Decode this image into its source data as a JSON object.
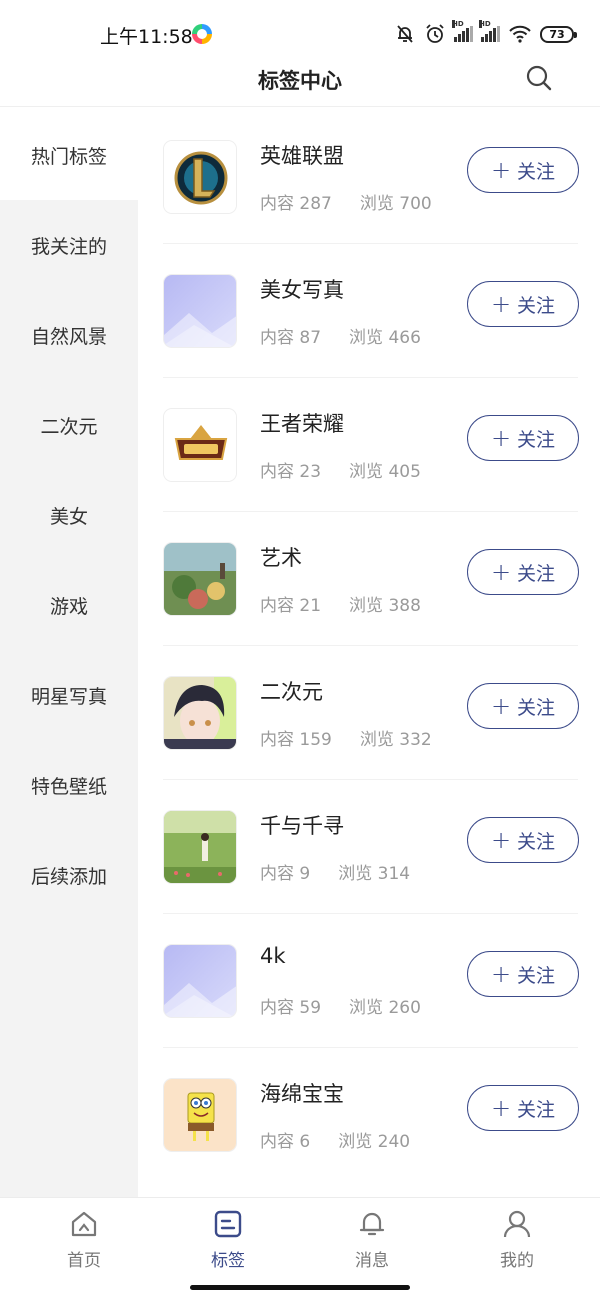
{
  "status_bar": {
    "time": "上午11:58",
    "battery": "73",
    "icons": [
      "mute-bell-icon",
      "alarm-icon",
      "signal-icon",
      "signal-icon",
      "wifi-icon",
      "battery-icon"
    ],
    "signal_badge": "HD"
  },
  "header": {
    "title": "标签中心",
    "search_icon": "search-icon"
  },
  "sidebar": {
    "items": [
      {
        "label": "热门标签"
      },
      {
        "label": "我关注的"
      },
      {
        "label": "自然风景"
      },
      {
        "label": "二次元"
      },
      {
        "label": "美女"
      },
      {
        "label": "游戏"
      },
      {
        "label": "明星写真"
      },
      {
        "label": "特色壁纸"
      },
      {
        "label": "后续添加"
      }
    ],
    "active_index": 0
  },
  "tags": [
    {
      "name": "英雄联盟",
      "content_label": "内容",
      "content": "287",
      "views_label": "浏览",
      "views": "700",
      "thumb": "lol-logo"
    },
    {
      "name": "美女写真",
      "content_label": "内容",
      "content": "87",
      "views_label": "浏览",
      "views": "466",
      "thumb": "placeholder"
    },
    {
      "name": "王者荣耀",
      "content_label": "内容",
      "content": "23",
      "views_label": "浏览",
      "views": "405",
      "thumb": "honor-of-kings-logo"
    },
    {
      "name": "艺术",
      "content_label": "内容",
      "content": "21",
      "views_label": "浏览",
      "views": "388",
      "thumb": "painting"
    },
    {
      "name": "二次元",
      "content_label": "内容",
      "content": "159",
      "views_label": "浏览",
      "views": "332",
      "thumb": "anime-portrait"
    },
    {
      "name": "千与千寻",
      "content_label": "内容",
      "content": "9",
      "views_label": "浏览",
      "views": "314",
      "thumb": "grass-field"
    },
    {
      "name": "4k",
      "content_label": "内容",
      "content": "59",
      "views_label": "浏览",
      "views": "260",
      "thumb": "placeholder"
    },
    {
      "name": "海绵宝宝",
      "content_label": "内容",
      "content": "6",
      "views_label": "浏览",
      "views": "240",
      "thumb": "spongebob"
    }
  ],
  "follow_button": {
    "plus": "+",
    "label": "关注"
  },
  "bottom_nav": {
    "items": [
      {
        "label": "首页",
        "icon": "home-icon"
      },
      {
        "label": "标签",
        "icon": "tag-list-icon"
      },
      {
        "label": "消息",
        "icon": "bell-icon"
      },
      {
        "label": "我的",
        "icon": "user-icon"
      }
    ],
    "active_index": 1
  },
  "colors": {
    "accent": "#3c4b8a",
    "sidebar_bg": "#f3f3f3",
    "muted_text": "#9a9a9a"
  }
}
